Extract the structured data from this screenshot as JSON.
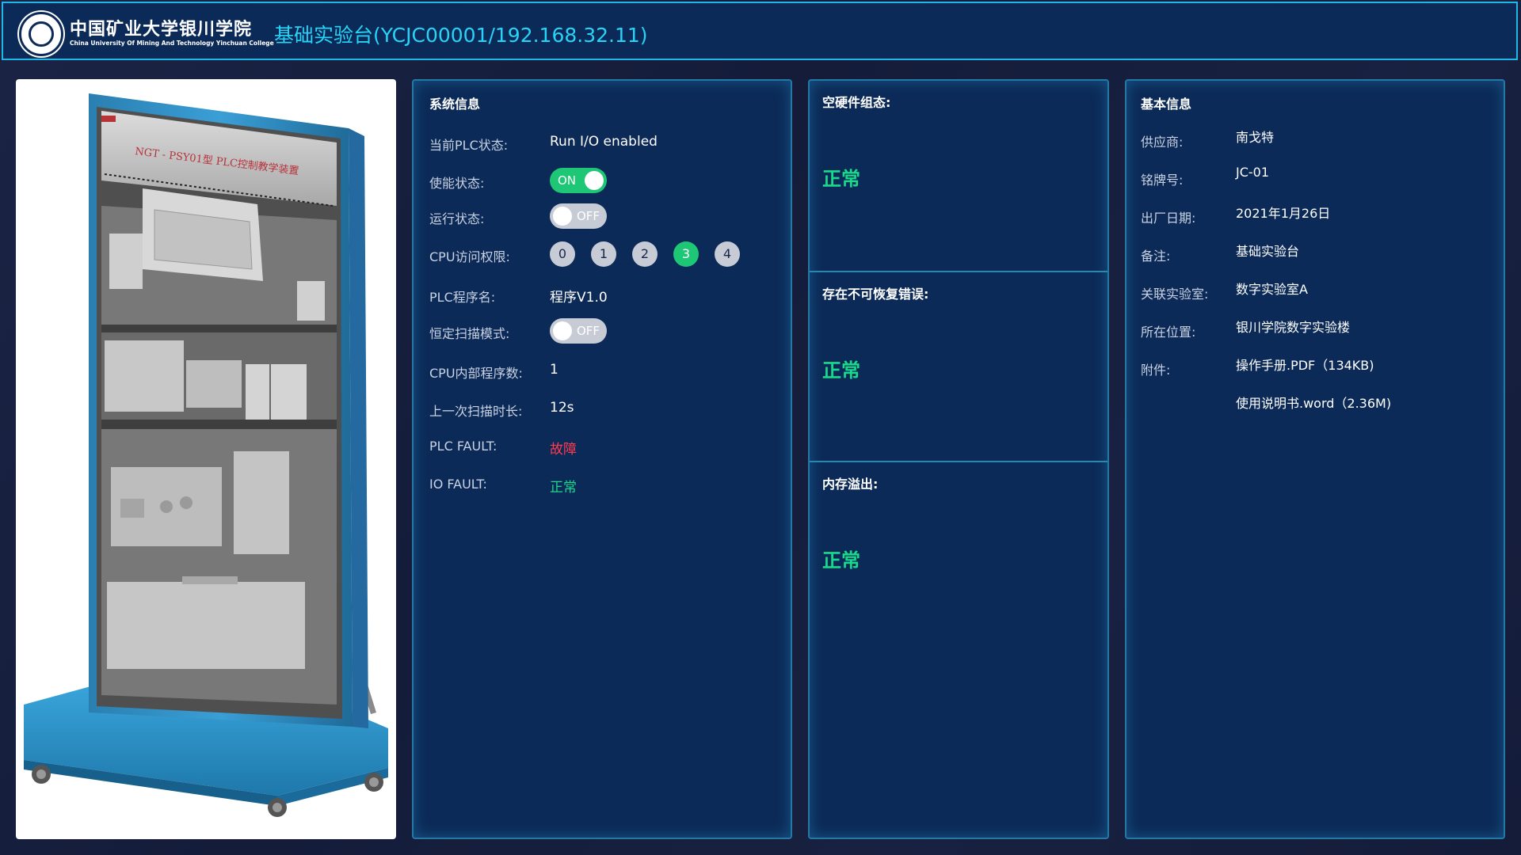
{
  "header": {
    "logo_cn": "中国矿业大学银川学院",
    "logo_en": "China University Of Mining And Technology Yinchuan College",
    "title": "基础实验台(YCJC00001/192.168.32.11)"
  },
  "device_image": {
    "label": "NGT - PSY01型 PLC控制教学装置"
  },
  "system_info": {
    "title": "系统信息",
    "plc_state_label": "当前PLC状态:",
    "plc_state_value": "Run I/O enabled",
    "enable_label": "使能状态:",
    "enable_toggle": "ON",
    "run_label": "运行状态:",
    "run_toggle": "OFF",
    "cpu_access_label": "CPU访问权限:",
    "cpu_levels": [
      "0",
      "1",
      "2",
      "3",
      "4"
    ],
    "cpu_level_selected": "3",
    "program_label": "PLC程序名:",
    "program_value": "程序V1.0",
    "const_scan_label": "恒定扫描模式:",
    "const_scan_toggle": "OFF",
    "cpu_program_count_label": "CPU内部程序数:",
    "cpu_program_count_value": "1",
    "last_scan_label": "上一次扫描时长:",
    "last_scan_value": "12s",
    "plc_fault_label": "PLC FAULT:",
    "plc_fault_value": "故障",
    "io_fault_label": "IO FAULT:",
    "io_fault_value": "正常",
    "colors": {
      "fault": "#ff3b4e",
      "ok": "#19d98a",
      "toggle_on": "#1ec776",
      "toggle_off": "#c7cbd6"
    }
  },
  "status_panel": {
    "sections": [
      {
        "label": "空硬件组态:",
        "value": "正常"
      },
      {
        "label": "存在不可恢复错误:",
        "value": "正常"
      },
      {
        "label": "内存溢出:",
        "value": "正常"
      }
    ]
  },
  "basic_info": {
    "title": "基本信息",
    "supplier_label": "供应商:",
    "supplier_value": "南戈特",
    "nameplate_label": "铭牌号:",
    "nameplate_value": "JC-01",
    "date_label": "出厂日期:",
    "date_value": "2021年1月26日",
    "remark_label": "备注:",
    "remark_value": "基础实验台",
    "lab_label": "关联实验室:",
    "lab_value": "数字实验室A",
    "location_label": "所在位置:",
    "location_value": "银川学院数字实验楼",
    "attachment_label": "附件:",
    "attachments": [
      "操作手册.PDF（134KB)",
      "使用说明书.word（2.36M)"
    ]
  }
}
